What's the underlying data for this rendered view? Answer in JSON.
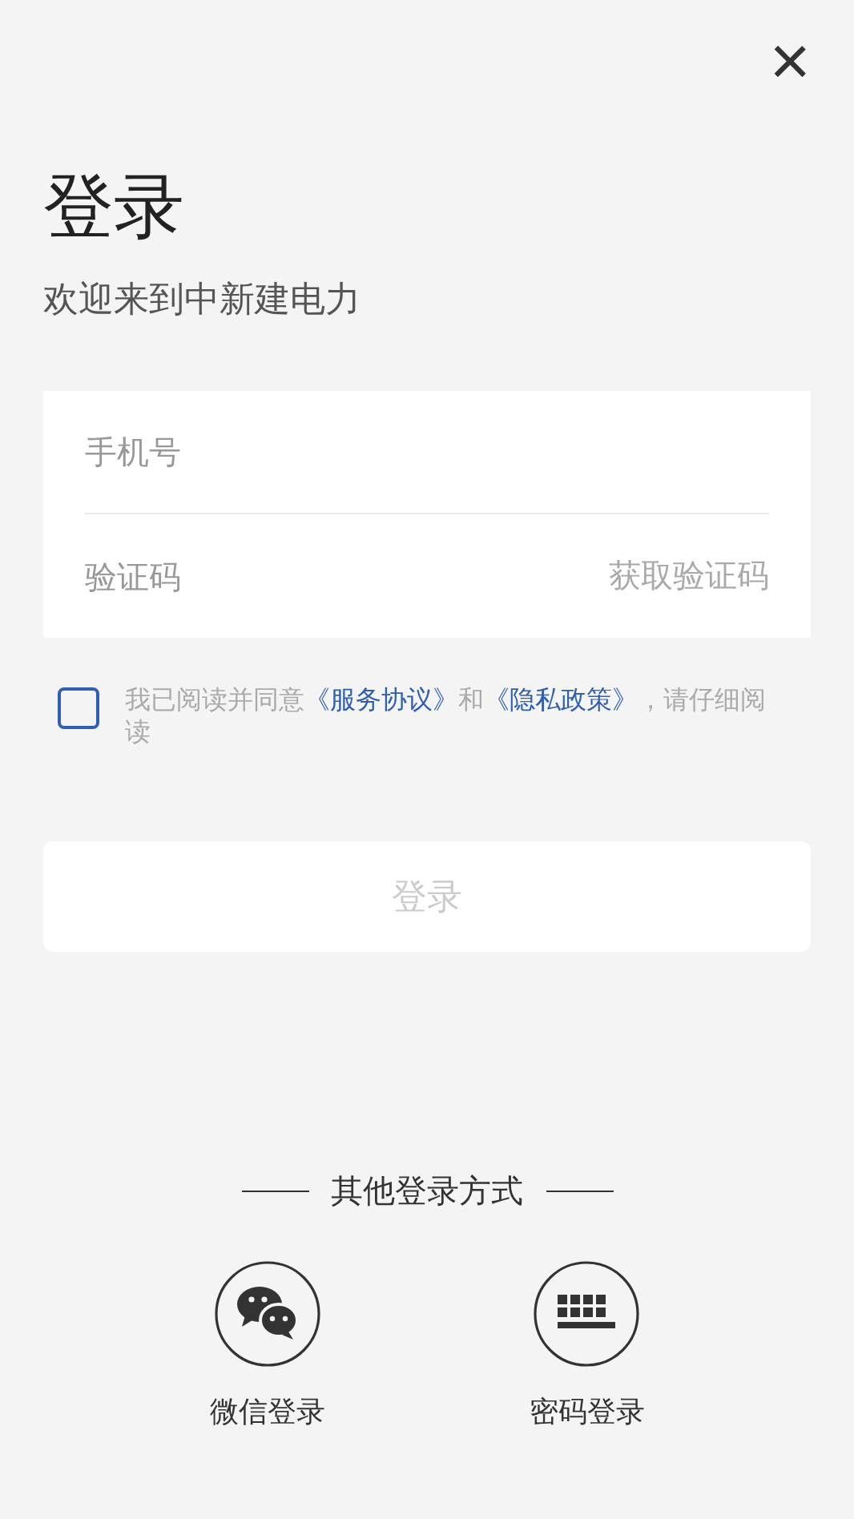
{
  "close": "×",
  "title": "登录",
  "subtitle": "欢迎来到中新建电力",
  "form": {
    "phone": {
      "placeholder": "手机号"
    },
    "code": {
      "placeholder": "验证码"
    },
    "get_code": "获取验证码"
  },
  "agreement": {
    "checked": false,
    "parts": [
      {
        "kind": "text",
        "text": "我已阅读并同意"
      },
      {
        "kind": "link",
        "text": "《服务协议》"
      },
      {
        "kind": "text",
        "text": "和"
      },
      {
        "kind": "link",
        "text": "《隐私政策》"
      },
      {
        "kind": "text",
        "text": "，请仔细阅读"
      }
    ]
  },
  "login_button": {
    "label": "登录",
    "disabled": true
  },
  "other": {
    "heading": "其他登录方式",
    "options": [
      {
        "kind": "wechat",
        "label": "微信登录"
      },
      {
        "kind": "keyboard",
        "label": "密码登录"
      }
    ]
  }
}
